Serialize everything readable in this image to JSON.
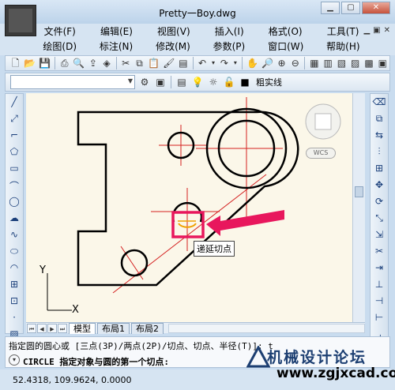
{
  "window": {
    "title": "Pretty一Boy.dwg"
  },
  "menu": {
    "row1": [
      "文件(F)",
      "编辑(E)",
      "视图(V)",
      "插入(I)",
      "格式(O)",
      "工具(T)"
    ],
    "row2": [
      "绘图(D)",
      "标注(N)",
      "修改(M)",
      "参数(P)",
      "窗口(W)",
      "帮助(H)"
    ]
  },
  "properties": {
    "linetype": "粗实线"
  },
  "viewcube": {
    "wcs": "WCS"
  },
  "tooltip": {
    "text": "递延切点"
  },
  "layout_tabs": [
    "模型",
    "布局1",
    "布局2"
  ],
  "command": {
    "history": "指定圆的圆心或 [三点(3P)/两点(2P)/切点、切点、半径(T)]: t",
    "prompt": "CIRCLE 指定对象与圆的第一个切点:"
  },
  "status": {
    "coordinates": "52.4318, 109.9624, 0.0000"
  },
  "ucs": {
    "x": "X",
    "y": "Y"
  },
  "watermark": {
    "title": "机械设计论坛",
    "url": "www.zgjxcad.com"
  },
  "colors": {
    "highlight": "#e8175d",
    "centerline": "#d42020",
    "drawing": "#000000",
    "canvas": "#fbf7e9"
  }
}
